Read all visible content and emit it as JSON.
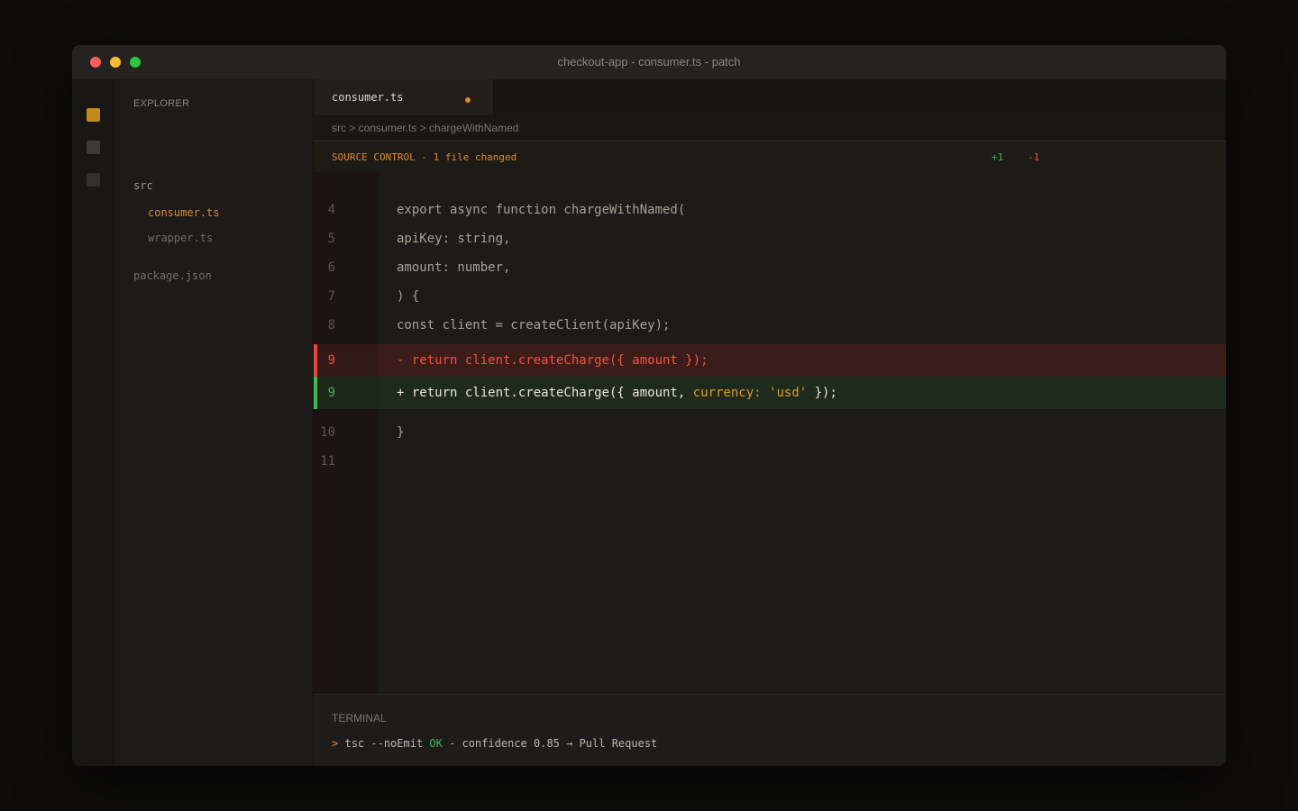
{
  "window": {
    "title": "checkout-app - consumer.ts - patch"
  },
  "sidebar": {
    "title": "EXPLORER",
    "tree": {
      "folder": "src",
      "active_file": "consumer.ts",
      "file2": "wrapper.ts",
      "root_file": "package.json"
    }
  },
  "tab": {
    "label": "consumer.ts",
    "modified": true
  },
  "breadcrumb": "src > consumer.ts > chargeWithNamed",
  "source_control": {
    "label": "SOURCE CONTROL - 1 file changed",
    "added": "+1",
    "removed": "-1"
  },
  "code": {
    "lines": [
      {
        "num": "4",
        "text": "export async function chargeWithNamed("
      },
      {
        "num": "5",
        "text": "apiKey: string,"
      },
      {
        "num": "6",
        "text": "amount: number,"
      },
      {
        "num": "7",
        "text": ") {"
      },
      {
        "num": "8",
        "text": "const client = createClient(apiKey);"
      }
    ],
    "deleted": {
      "num": "9",
      "text": "- return client.createCharge({ amount });"
    },
    "added": {
      "num": "9",
      "prefix": "+ return client.createCharge({ amount, ",
      "highlight_key": "currency:",
      "highlight_value": "'usd'",
      "suffix": " });"
    },
    "tail": [
      {
        "num": "10",
        "text": "}"
      },
      {
        "num": "11",
        "text": ""
      }
    ]
  },
  "terminal": {
    "title": "TERMINAL",
    "prompt": ">",
    "command": "tsc --noEmit",
    "status": "OK",
    "message": " - confidence 0.85 → Pull Request"
  },
  "colors": {
    "accent": "#e08a2a",
    "added": "#3fb950",
    "removed": "#f2563f"
  }
}
